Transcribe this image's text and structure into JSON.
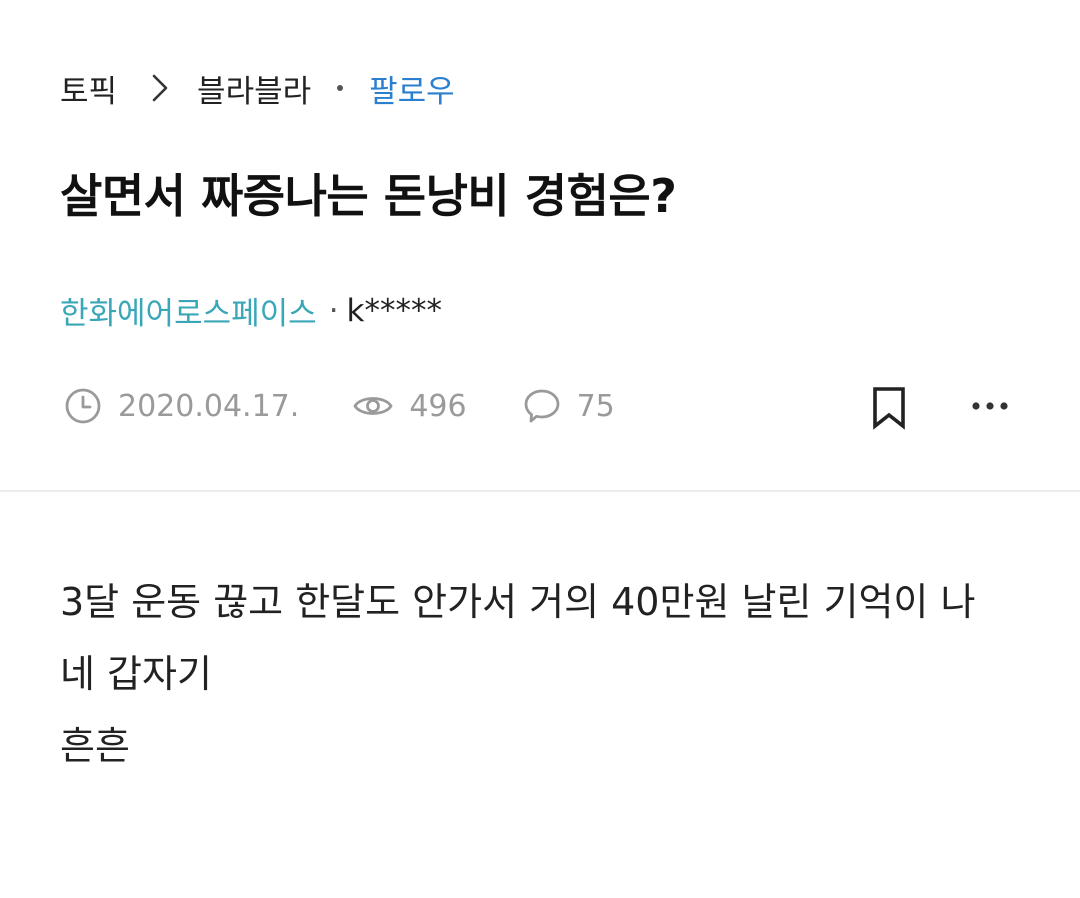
{
  "breadcrumb": {
    "topic": "토픽",
    "board": "블라블라",
    "follow": "팔로우"
  },
  "post": {
    "title": "살면서 짜증나는 돈낭비 경험은?",
    "company": "한화에어로스페이스",
    "separator": "·",
    "nickname": "k*****",
    "date": "2020.04.17.",
    "views": "496",
    "comments": "75",
    "body_lines": [
      "3달 운동 끊고 한달도 안가서 거의 40만원 날린 기억이 나",
      "네 갑자기",
      "흔흔"
    ]
  },
  "icons": {
    "chevron": "chevron-right-icon",
    "clock": "clock-icon",
    "eye": "eye-icon",
    "comment": "comment-icon",
    "bookmark": "bookmark-icon",
    "more": "more-dots-icon"
  },
  "colors": {
    "follow": "#2a7fcf",
    "company": "#3aa7b8",
    "meta": "#9a9a9a",
    "divider": "#ececec"
  }
}
